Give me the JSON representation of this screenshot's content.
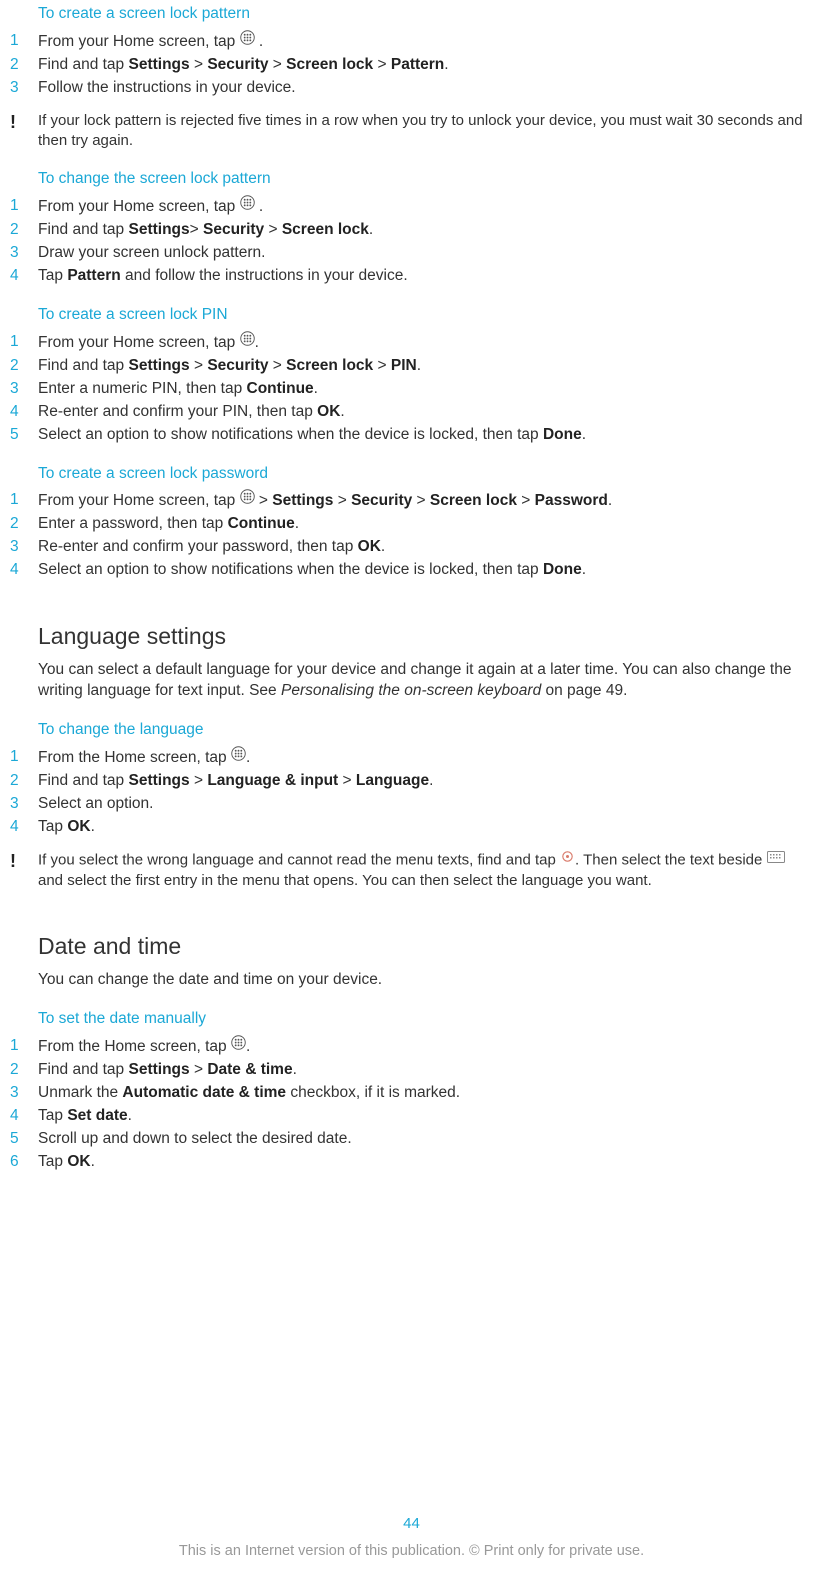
{
  "sections": {
    "s1": {
      "title": "To create a screen lock pattern",
      "steps": [
        {
          "n": "1",
          "pre": "From your Home screen, tap ",
          "icon": "apps",
          "post": " ."
        },
        {
          "n": "2",
          "parts": [
            "Find and tap ",
            {
              "b": "Settings"
            },
            " > ",
            {
              "b": "Security"
            },
            " > ",
            {
              "b": "Screen lock"
            },
            " > ",
            {
              "b": "Pattern"
            },
            "."
          ]
        },
        {
          "n": "3",
          "parts": [
            "Follow the instructions in your device."
          ]
        }
      ],
      "note": "If your lock pattern is rejected five times in a row when you try to unlock your device, you must wait 30 seconds and then try again."
    },
    "s2": {
      "title": "To change the screen lock pattern",
      "steps": [
        {
          "n": "1",
          "pre": "From your Home screen, tap ",
          "icon": "apps",
          "post": " ."
        },
        {
          "n": "2",
          "parts": [
            "Find and tap ",
            {
              "b": "Settings"
            },
            "> ",
            {
              "b": "Security"
            },
            " > ",
            {
              "b": "Screen lock"
            },
            "."
          ]
        },
        {
          "n": "3",
          "parts": [
            "Draw your screen unlock pattern."
          ]
        },
        {
          "n": "4",
          "parts": [
            "Tap ",
            {
              "b": "Pattern"
            },
            " and follow the instructions in your device."
          ]
        }
      ]
    },
    "s3": {
      "title": "To create a screen lock PIN",
      "steps": [
        {
          "n": "1",
          "pre": "From your Home screen, tap ",
          "icon": "apps",
          "post": "."
        },
        {
          "n": "2",
          "parts": [
            "Find and tap ",
            {
              "b": "Settings"
            },
            " > ",
            {
              "b": "Security"
            },
            " > ",
            {
              "b": "Screen lock"
            },
            " > ",
            {
              "b": "PIN"
            },
            "."
          ]
        },
        {
          "n": "3",
          "parts": [
            "Enter a numeric PIN, then tap ",
            {
              "b": "Continue"
            },
            "."
          ]
        },
        {
          "n": "4",
          "parts": [
            "Re-enter and confirm your PIN, then tap ",
            {
              "b": "OK"
            },
            "."
          ]
        },
        {
          "n": "5",
          "parts": [
            "Select an option to show notifications when the device is locked, then tap ",
            {
              "b": "Done"
            },
            "."
          ]
        }
      ]
    },
    "s4": {
      "title": "To create a screen lock password",
      "steps": [
        {
          "n": "1",
          "pre": "From your Home screen, tap ",
          "icon": "apps",
          "post_parts": [
            " > ",
            {
              "b": "Settings"
            },
            " > ",
            {
              "b": "Security"
            },
            " > ",
            {
              "b": "Screen lock"
            },
            " > ",
            {
              "b": "Password"
            },
            "."
          ]
        },
        {
          "n": "2",
          "parts": [
            "Enter a password, then tap ",
            {
              "b": "Continue"
            },
            "."
          ]
        },
        {
          "n": "3",
          "parts": [
            "Re-enter and confirm your password, then tap ",
            {
              "b": "OK"
            },
            "."
          ]
        },
        {
          "n": "4",
          "parts": [
            "Select an option to show notifications when the device is locked, then tap ",
            {
              "b": "Done"
            },
            "."
          ]
        }
      ]
    },
    "lang": {
      "heading": "Language settings",
      "intro_a": "You can select a default language for your device and change it again at a later time. You can also change the writing language for text input. See ",
      "intro_italic": "Personalising the on-screen keyboard",
      "intro_b": " on page 49."
    },
    "s5": {
      "title": "To change the language",
      "steps": [
        {
          "n": "1",
          "pre": "From the Home screen, tap ",
          "icon": "apps",
          "post": "."
        },
        {
          "n": "2",
          "parts": [
            "Find and tap ",
            {
              "b": "Settings"
            },
            " > ",
            {
              "b": "Language & input"
            },
            " > ",
            {
              "b": "Language"
            },
            "."
          ]
        },
        {
          "n": "3",
          "parts": [
            "Select an option."
          ]
        },
        {
          "n": "4",
          "parts": [
            "Tap ",
            {
              "b": "OK"
            },
            "."
          ]
        }
      ],
      "note_parts": [
        "If you select the wrong language and cannot read the menu texts, find and tap ",
        {
          "icon": "gear"
        },
        ". Then select the text beside ",
        {
          "icon": "keyboard"
        },
        " and select the first entry in the menu that opens. You can then select the language you want."
      ]
    },
    "datetime": {
      "heading": "Date and time",
      "intro": "You can change the date and time on your device."
    },
    "s6": {
      "title": "To set the date manually",
      "steps": [
        {
          "n": "1",
          "pre": "From the Home screen, tap ",
          "icon": "apps",
          "post": "."
        },
        {
          "n": "2",
          "parts": [
            "Find and tap ",
            {
              "b": "Settings"
            },
            " > ",
            {
              "b": "Date & time"
            },
            "."
          ]
        },
        {
          "n": "3",
          "parts": [
            "Unmark the ",
            {
              "b": "Automatic date & time"
            },
            " checkbox, if it is marked."
          ]
        },
        {
          "n": "4",
          "parts": [
            "Tap ",
            {
              "b": "Set date"
            },
            "."
          ]
        },
        {
          "n": "5",
          "parts": [
            "Scroll up and down to select the desired date."
          ]
        },
        {
          "n": "6",
          "parts": [
            "Tap ",
            {
              "b": "OK"
            },
            "."
          ]
        }
      ]
    }
  },
  "page_number": "44",
  "disclaimer": "This is an Internet version of this publication. © Print only for private use."
}
